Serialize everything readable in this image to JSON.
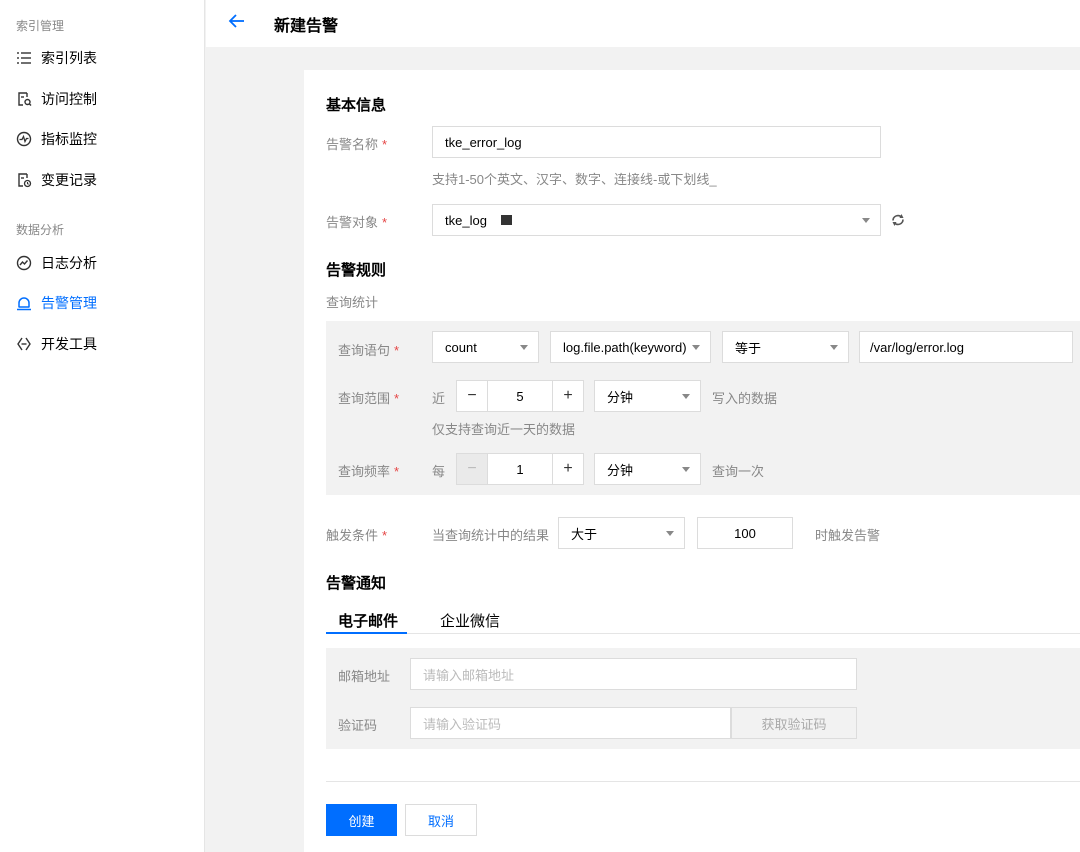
{
  "sidebar": {
    "group1": "索引管理",
    "group2": "数据分析",
    "items": [
      {
        "label": "索引列表",
        "icon": "list-icon"
      },
      {
        "label": "访问控制",
        "icon": "access-control-icon"
      },
      {
        "label": "指标监控",
        "icon": "monitor-icon"
      },
      {
        "label": "变更记录",
        "icon": "change-log-icon"
      },
      {
        "label": "日志分析",
        "icon": "log-analysis-icon"
      },
      {
        "label": "告警管理",
        "icon": "alarm-icon",
        "active": true
      },
      {
        "label": "开发工具",
        "icon": "dev-tools-icon"
      }
    ]
  },
  "header": {
    "title": "新建告警"
  },
  "basic": {
    "title": "基本信息",
    "name_label": "告警名称",
    "name_value": "tke_error_log",
    "name_hint": "支持1-50个英文、汉字、数字、连接线-或下划线_",
    "target_label": "告警对象",
    "target_value": "tke_log"
  },
  "rules": {
    "title": "告警规则",
    "subtitle": "查询统计",
    "query_label": "查询语句",
    "query_func": "count",
    "query_field": "log.file.path(keyword)",
    "query_op": "等于",
    "query_value": "/var/log/error.log",
    "range_label": "查询范围",
    "range_prefix": "近",
    "range_value": "5",
    "range_unit": "分钟",
    "range_suffix": "写入的数据",
    "range_hint": "仅支持查询近一天的数据",
    "freq_label": "查询频率",
    "freq_prefix": "每",
    "freq_value": "1",
    "freq_unit": "分钟",
    "freq_suffix": "查询一次",
    "trigger_label": "触发条件",
    "trigger_prefix": "当查询统计中的结果",
    "trigger_op": "大于",
    "trigger_value": "100",
    "trigger_suffix": "时触发告警",
    "minus": "−",
    "plus": "+"
  },
  "notify": {
    "title": "告警通知",
    "tabs": [
      "电子邮件",
      "企业微信"
    ],
    "email_label": "邮箱地址",
    "email_placeholder": "请输入邮箱地址",
    "code_label": "验证码",
    "code_placeholder": "请输入验证码",
    "code_button": "获取验证码"
  },
  "footer": {
    "create": "创建",
    "cancel": "取消"
  },
  "required_mark": "*",
  "colors": {
    "primary": "#006eff",
    "required": "#e54545"
  }
}
